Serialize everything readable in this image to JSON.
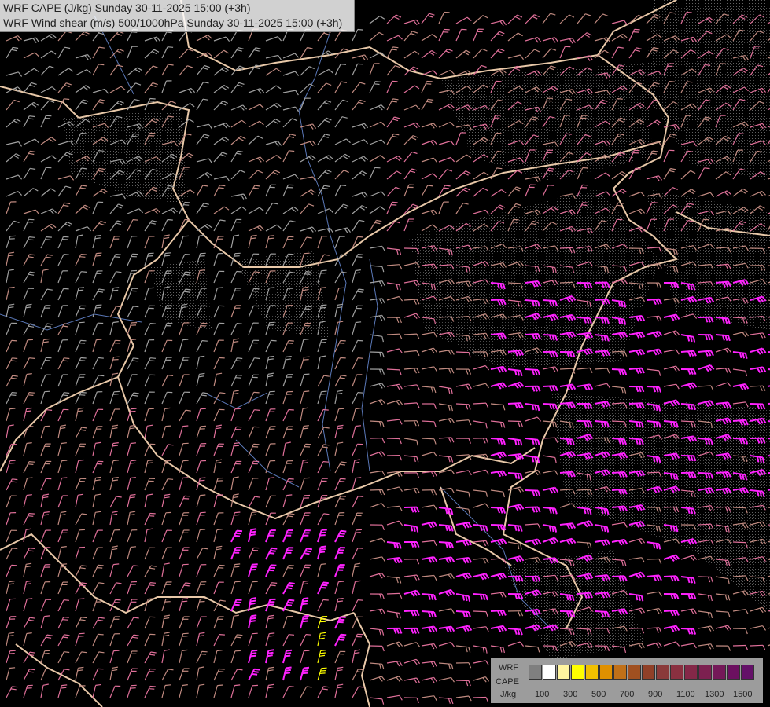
{
  "title": {
    "line1": "WRF CAPE (J/kg) Sunday 30-11-2025 15:00 (+3h)",
    "line2": "WRF Wind shear (m/s) 500/1000hPa Sunday 30-11-2025 15:00 (+3h)"
  },
  "legend": {
    "model": "WRF",
    "variable": "CAPE",
    "unit": "J/kg",
    "ticks": [
      "100",
      "300",
      "500",
      "700",
      "900",
      "1100",
      "1300",
      "1500"
    ],
    "colors": [
      "#7f7f7f",
      "#ffffff",
      "#fff5a0",
      "#ffff00",
      "#f0c000",
      "#e09000",
      "#c07018",
      "#a05020",
      "#904028",
      "#8a3a3a",
      "#8a3040",
      "#842848",
      "#7c2050",
      "#741858",
      "#6c1060",
      "#641068"
    ]
  },
  "map_colors": {
    "background": "#000000",
    "border": "#e8c8a8",
    "river": "#5a78b8",
    "barb_low": "#a0a0a0",
    "barb_mid": "#c08a80",
    "barb_high": "#e0709a",
    "barb_magenta": "#ff22ff",
    "barb_yellow": "#ffff00"
  }
}
